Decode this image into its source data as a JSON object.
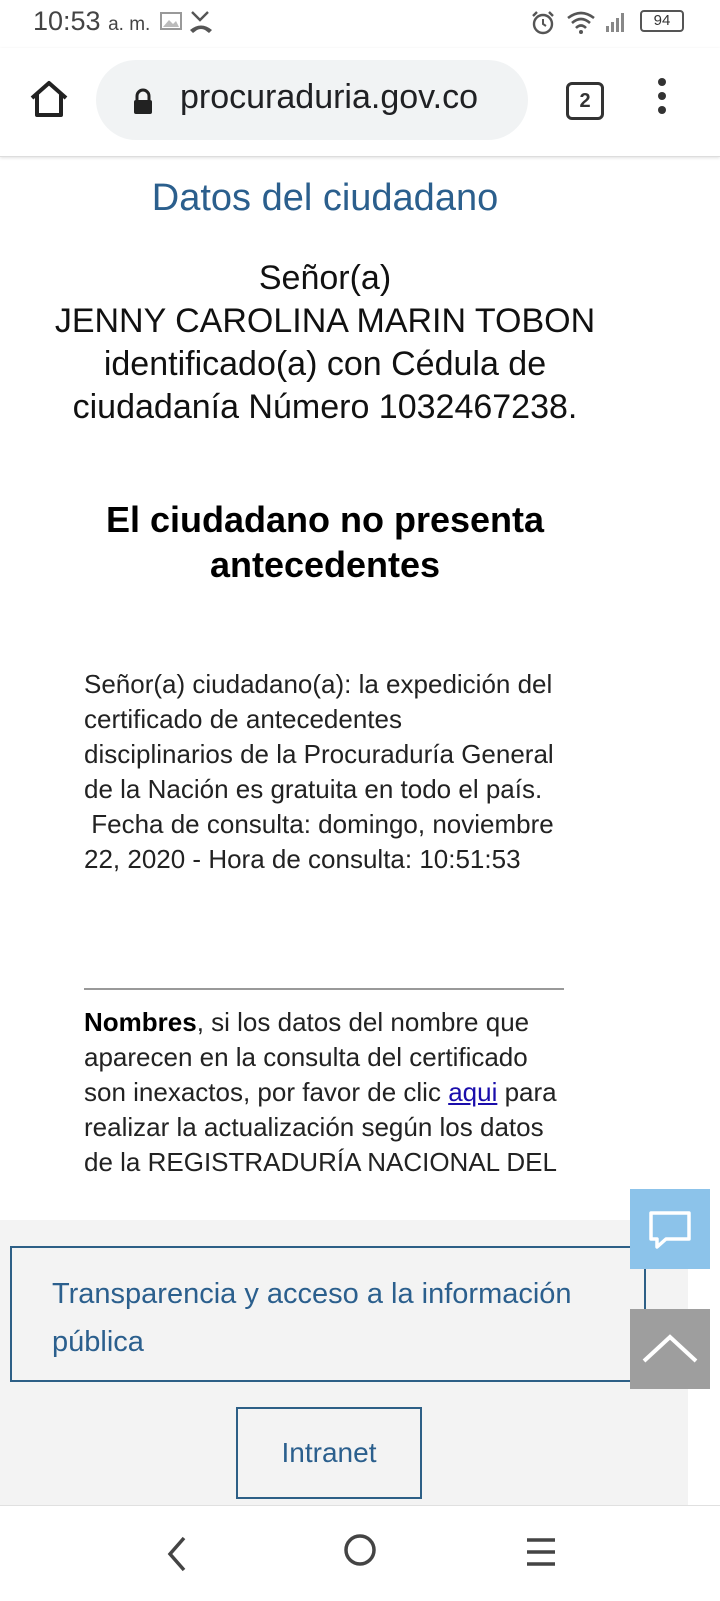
{
  "status_bar": {
    "time": "10:53",
    "ampm": "a. m.",
    "battery": "94"
  },
  "browser": {
    "url": "procuraduria.gov.co",
    "tab_count": "2"
  },
  "content": {
    "section_title": "Datos del ciudadano",
    "salutation": "Señor(a)",
    "citizen_name": "JENNY CAROLINA MARIN TOBON",
    "id_line": "identificado(a) con Cédula de ciudadanía Número 1032467238.",
    "result_heading": "El ciudadano no presenta antecedentes",
    "notice_text": "Señor(a) ciudadano(a): la expedición del certificado de antecedentes disciplinarios de la Procuraduría General de la Nación es gratuita en todo el país.",
    "consult_date": " Fecha de consulta: domingo, noviembre 22, 2020 - Hora de consulta: 10:51:53",
    "names_label": "Nombres",
    "names_text_before": ", si los datos del nombre que aparecen en la consulta del certificado son inexactos, por favor de clic ",
    "names_link": "aqui",
    "names_text_after": " para realizar la actualización según los datos de la REGISTRADURÍA NACIONAL DEL"
  },
  "footer": {
    "transparency_link": "Transparencia y acceso a la información pública",
    "intranet_label": "Intranet"
  },
  "colors": {
    "accent_blue": "#2b5f8d",
    "chat_button": "#8cc3ea",
    "scroll_top_button": "#9e9e9e",
    "link": "#1a0dab"
  }
}
